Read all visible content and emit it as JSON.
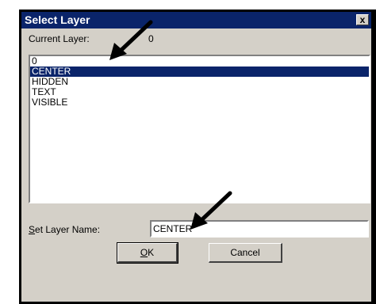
{
  "dialog": {
    "title": "Select Layer",
    "close_glyph": "x"
  },
  "current_layer": {
    "label": "Current Layer:",
    "value": "0"
  },
  "layer_list": {
    "items": [
      "0",
      "CENTER",
      "HIDDEN",
      "TEXT",
      "VISIBLE"
    ],
    "selected": "CENTER"
  },
  "set_layer": {
    "label_accel": "S",
    "label_rest": "et Layer Name:",
    "value": "CENTER"
  },
  "buttons": {
    "ok_accel": "O",
    "ok_rest": "K",
    "cancel": "Cancel"
  },
  "colors": {
    "titlebar": "#0a246a",
    "dialog_bg": "#d4d0c8",
    "selection": "#0a246a",
    "arrow": "#000000"
  },
  "icons": {
    "close": "close-icon",
    "pointer": "arrow-pointer-icon"
  }
}
